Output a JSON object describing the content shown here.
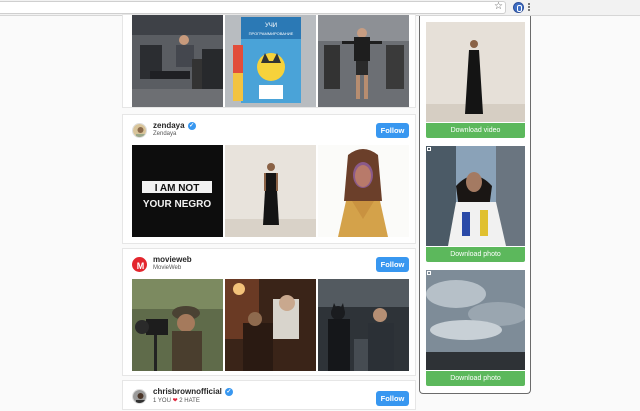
{
  "browser": {
    "star_icon": "star-icon",
    "extension_icon": "download-extension-icon",
    "menu_icon": "menu-icon"
  },
  "feed": {
    "follow_label": "Follow",
    "posts": [
      {
        "username": "zendaya",
        "subtitle": "Zendaya",
        "verified": true,
        "photo_texts": [
          "I AM NOT",
          "YOUR NEGRO"
        ]
      },
      {
        "username": "movieweb",
        "subtitle": "MovieWeb",
        "verified": false,
        "avatar_letter": "M"
      },
      {
        "username": "chrisbrownofficial",
        "subtitle_before": "1 YOU",
        "subtitle_after": "2 HATE",
        "verified": true
      }
    ],
    "top_row_poster_text": [
      "УЧИ",
      "ПРОГРАММИРОВАНИЕ"
    ]
  },
  "side_panel": {
    "items": [
      {
        "button": "Download video"
      },
      {
        "button": "Download photo"
      },
      {
        "button": "Download photo"
      }
    ]
  },
  "colors": {
    "follow_blue": "#3897f0",
    "download_green": "#5cb85c",
    "heart_red": "#e2263d"
  }
}
